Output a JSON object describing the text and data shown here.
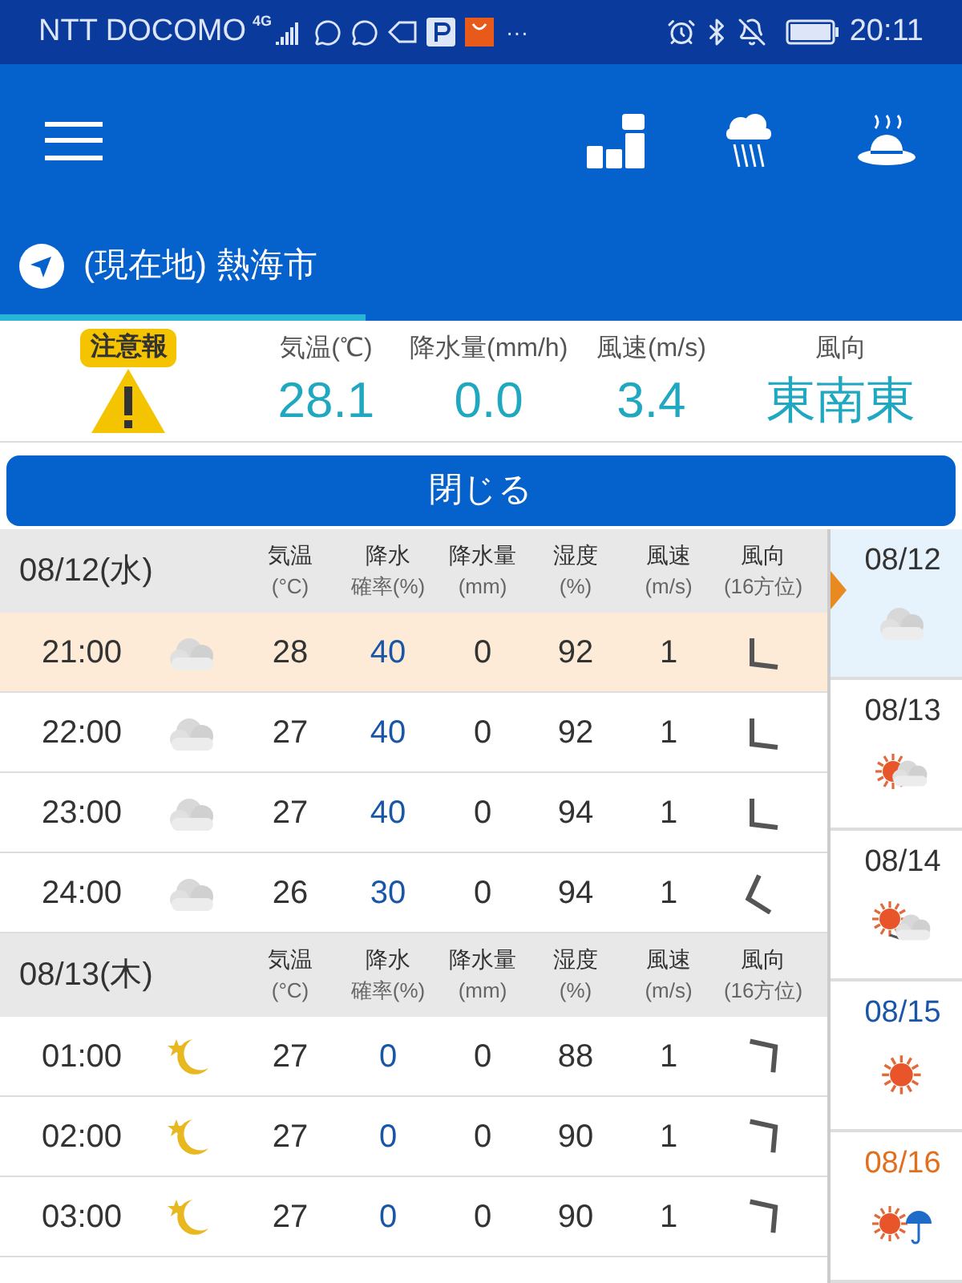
{
  "status_bar": {
    "carrier": "NTT DOCOMO",
    "network": "4G",
    "more": "···",
    "time": "20:11"
  },
  "location_tab": {
    "label": "(現在地) 熱海市",
    "selected": true
  },
  "current": {
    "warning": "注意報",
    "items": [
      {
        "label": "気温(℃)",
        "value": "28.1"
      },
      {
        "label": "降水量(mm/h)",
        "value": "0.0"
      },
      {
        "label": "風速(m/s)",
        "value": "3.4"
      },
      {
        "label": "風向",
        "value": "東南東"
      }
    ]
  },
  "close_button": "閉じる",
  "days": [
    {
      "date": "08/12(水)",
      "columns": [
        {
          "line1": "気温",
          "line2": "(°C)"
        },
        {
          "line1": "降水",
          "line2": "確率(%)"
        },
        {
          "line1": "降水量",
          "line2": "(mm)"
        },
        {
          "line1": "湿度",
          "line2": "(%)"
        },
        {
          "line1": "風速",
          "line2": "(m/s)"
        },
        {
          "line1": "風向",
          "line2": "(16方位)"
        }
      ],
      "hours": [
        {
          "time": "21:00",
          "weather_icon": {
            "kind": "cloudy"
          },
          "temp": "28",
          "prob": "40",
          "amount": "0",
          "humidity": "92",
          "wind": "1",
          "wind_arrow": {
            "kind": "sw"
          },
          "selected": true
        },
        {
          "time": "22:00",
          "weather_icon": {
            "kind": "cloudy"
          },
          "temp": "27",
          "prob": "40",
          "amount": "0",
          "humidity": "92",
          "wind": "1",
          "wind_arrow": {
            "kind": "sw"
          },
          "selected": false
        },
        {
          "time": "23:00",
          "weather_icon": {
            "kind": "cloudy"
          },
          "temp": "27",
          "prob": "40",
          "amount": "0",
          "humidity": "94",
          "wind": "1",
          "wind_arrow": {
            "kind": "sw"
          },
          "selected": false
        },
        {
          "time": "24:00",
          "weather_icon": {
            "kind": "cloudy"
          },
          "temp": "26",
          "prob": "30",
          "amount": "0",
          "humidity": "94",
          "wind": "1",
          "wind_arrow": {
            "kind": "wsw"
          },
          "selected": false
        }
      ]
    },
    {
      "date": "08/13(木)",
      "columns": [
        {
          "line1": "気温",
          "line2": "(°C)"
        },
        {
          "line1": "降水",
          "line2": "確率(%)"
        },
        {
          "line1": "降水量",
          "line2": "(mm)"
        },
        {
          "line1": "湿度",
          "line2": "(%)"
        },
        {
          "line1": "風速",
          "line2": "(m/s)"
        },
        {
          "line1": "風向",
          "line2": "(16方位)"
        }
      ],
      "hours": [
        {
          "time": "01:00",
          "weather_icon": {
            "kind": "moon"
          },
          "temp": "27",
          "prob": "0",
          "amount": "0",
          "humidity": "88",
          "wind": "1",
          "wind_arrow": {
            "kind": "ne"
          },
          "selected": false
        },
        {
          "time": "02:00",
          "weather_icon": {
            "kind": "moon"
          },
          "temp": "27",
          "prob": "0",
          "amount": "0",
          "humidity": "90",
          "wind": "1",
          "wind_arrow": {
            "kind": "ne"
          },
          "selected": false
        },
        {
          "time": "03:00",
          "weather_icon": {
            "kind": "moon"
          },
          "temp": "27",
          "prob": "0",
          "amount": "0",
          "humidity": "90",
          "wind": "1",
          "wind_arrow": {
            "kind": "ne"
          },
          "selected": false
        }
      ]
    }
  ],
  "side_days": [
    {
      "date": "08/12",
      "color": "#333333",
      "weather_icon": {
        "kind": "cloudy"
      },
      "selected": true
    },
    {
      "date": "08/13",
      "color": "#333333",
      "weather_icon": {
        "kind": "suncloud"
      },
      "selected": false
    },
    {
      "date": "08/14",
      "color": "#333333",
      "weather_icon": {
        "kind": "suntocloud"
      },
      "selected": false
    },
    {
      "date": "08/15",
      "color": "#1a56a8",
      "weather_icon": {
        "kind": "sunny"
      },
      "selected": false
    },
    {
      "date": "08/16",
      "color": "#e07020",
      "weather_icon": {
        "kind": "sunumbrella"
      },
      "selected": false
    }
  ]
}
